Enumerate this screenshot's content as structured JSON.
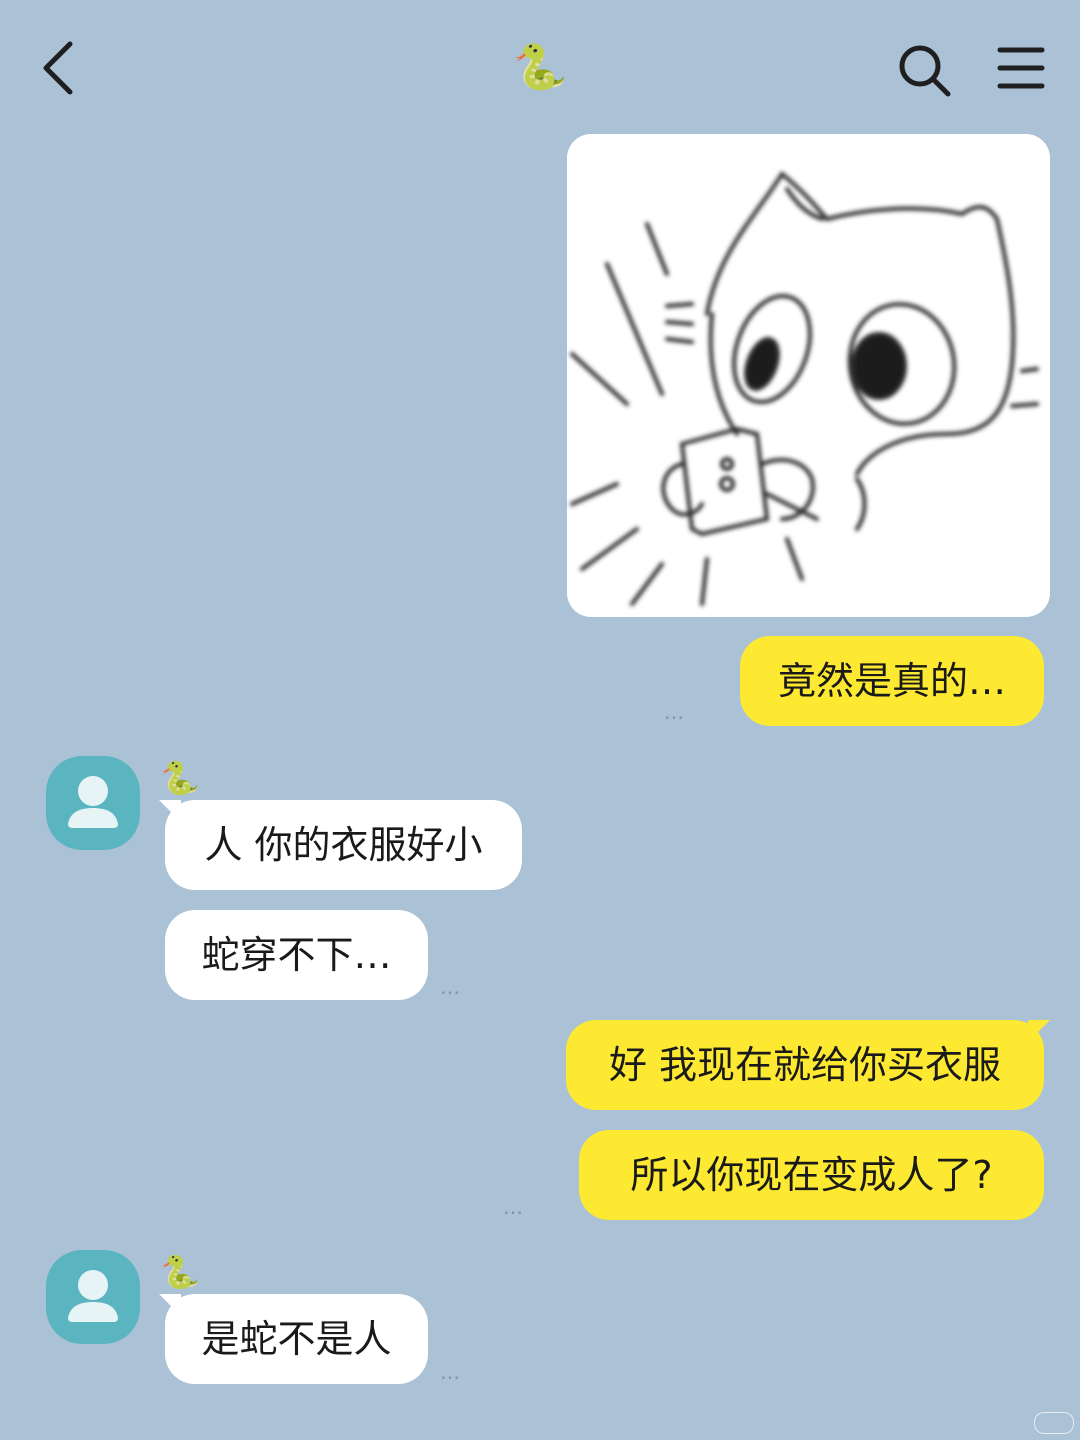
{
  "header": {
    "title": "🐍",
    "back_icon": "chevron-left-icon",
    "search_icon": "search-icon",
    "menu_icon": "hamburger-menu-icon"
  },
  "messages": [
    {
      "side": "me",
      "type": "image",
      "icon": "surprised-cat-sticker"
    },
    {
      "side": "me",
      "type": "text",
      "text": "竟然是真的…"
    },
    {
      "side": "them",
      "sender": "🐍",
      "type": "text",
      "text": "人 你的衣服好小"
    },
    {
      "side": "them",
      "type": "text",
      "text": "蛇穿不下…"
    },
    {
      "side": "me",
      "type": "text",
      "text": "好 我现在就给你买衣服"
    },
    {
      "side": "me",
      "type": "text",
      "text": "所以你现在变成人了?"
    },
    {
      "side": "them",
      "sender": "🐍",
      "type": "text",
      "text": "是蛇不是人"
    }
  ],
  "read_indicator": "…",
  "colors": {
    "background": "#abc1d6",
    "my_bubble": "#fee932",
    "their_bubble": "#ffffff",
    "avatar": "#5bb5c1"
  }
}
